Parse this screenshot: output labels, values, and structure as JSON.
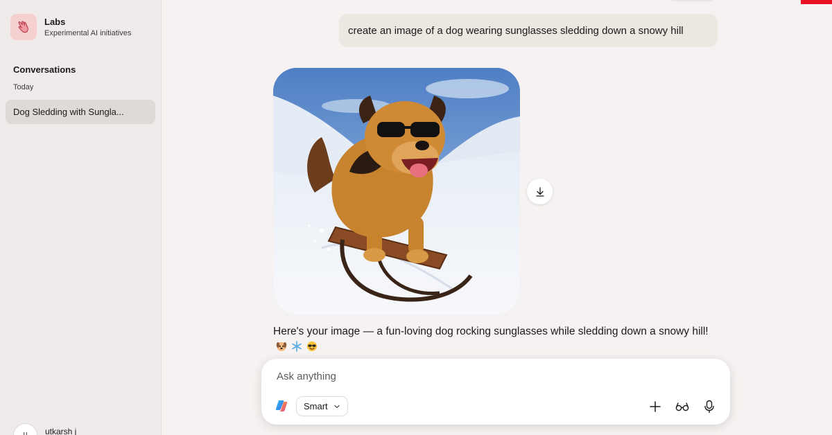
{
  "sidebar": {
    "app_title": "Labs",
    "app_subtitle": "Experimental AI initiatives",
    "conversations_heading": "Conversations",
    "group_label": "Today",
    "items": [
      {
        "label": "Dog Sledding with Sungla..."
      }
    ],
    "user": {
      "initial": "u",
      "name": "utkarsh j"
    }
  },
  "chat": {
    "user_message": "create an image of a dog wearing sunglasses sledding down a snowy hill",
    "reply_text": "Here's your image — a fun-loving dog rocking sunglasses while sledding down a snowy hill!",
    "reply_emojis": [
      "dog-face-emoji",
      "snowflake-emoji",
      "smiling-face-with-sunglasses-emoji"
    ],
    "image_icon": "generated-image",
    "download_icon": "download-icon"
  },
  "composer": {
    "placeholder": "Ask anything",
    "mode_label": "Smart",
    "icons": [
      "copilot-logo-icon",
      "chevron-down-icon",
      "plus-icon",
      "glasses-icon",
      "microphone-icon"
    ]
  },
  "colors": {
    "page_bg": "#f6f2f1",
    "sidebar_bg": "#efebea",
    "selected_item_bg": "#dedad8",
    "user_bubble_bg": "#ece7e1",
    "brand_logo_bg": "#f6cfd0",
    "accent_red": "#e81123"
  }
}
